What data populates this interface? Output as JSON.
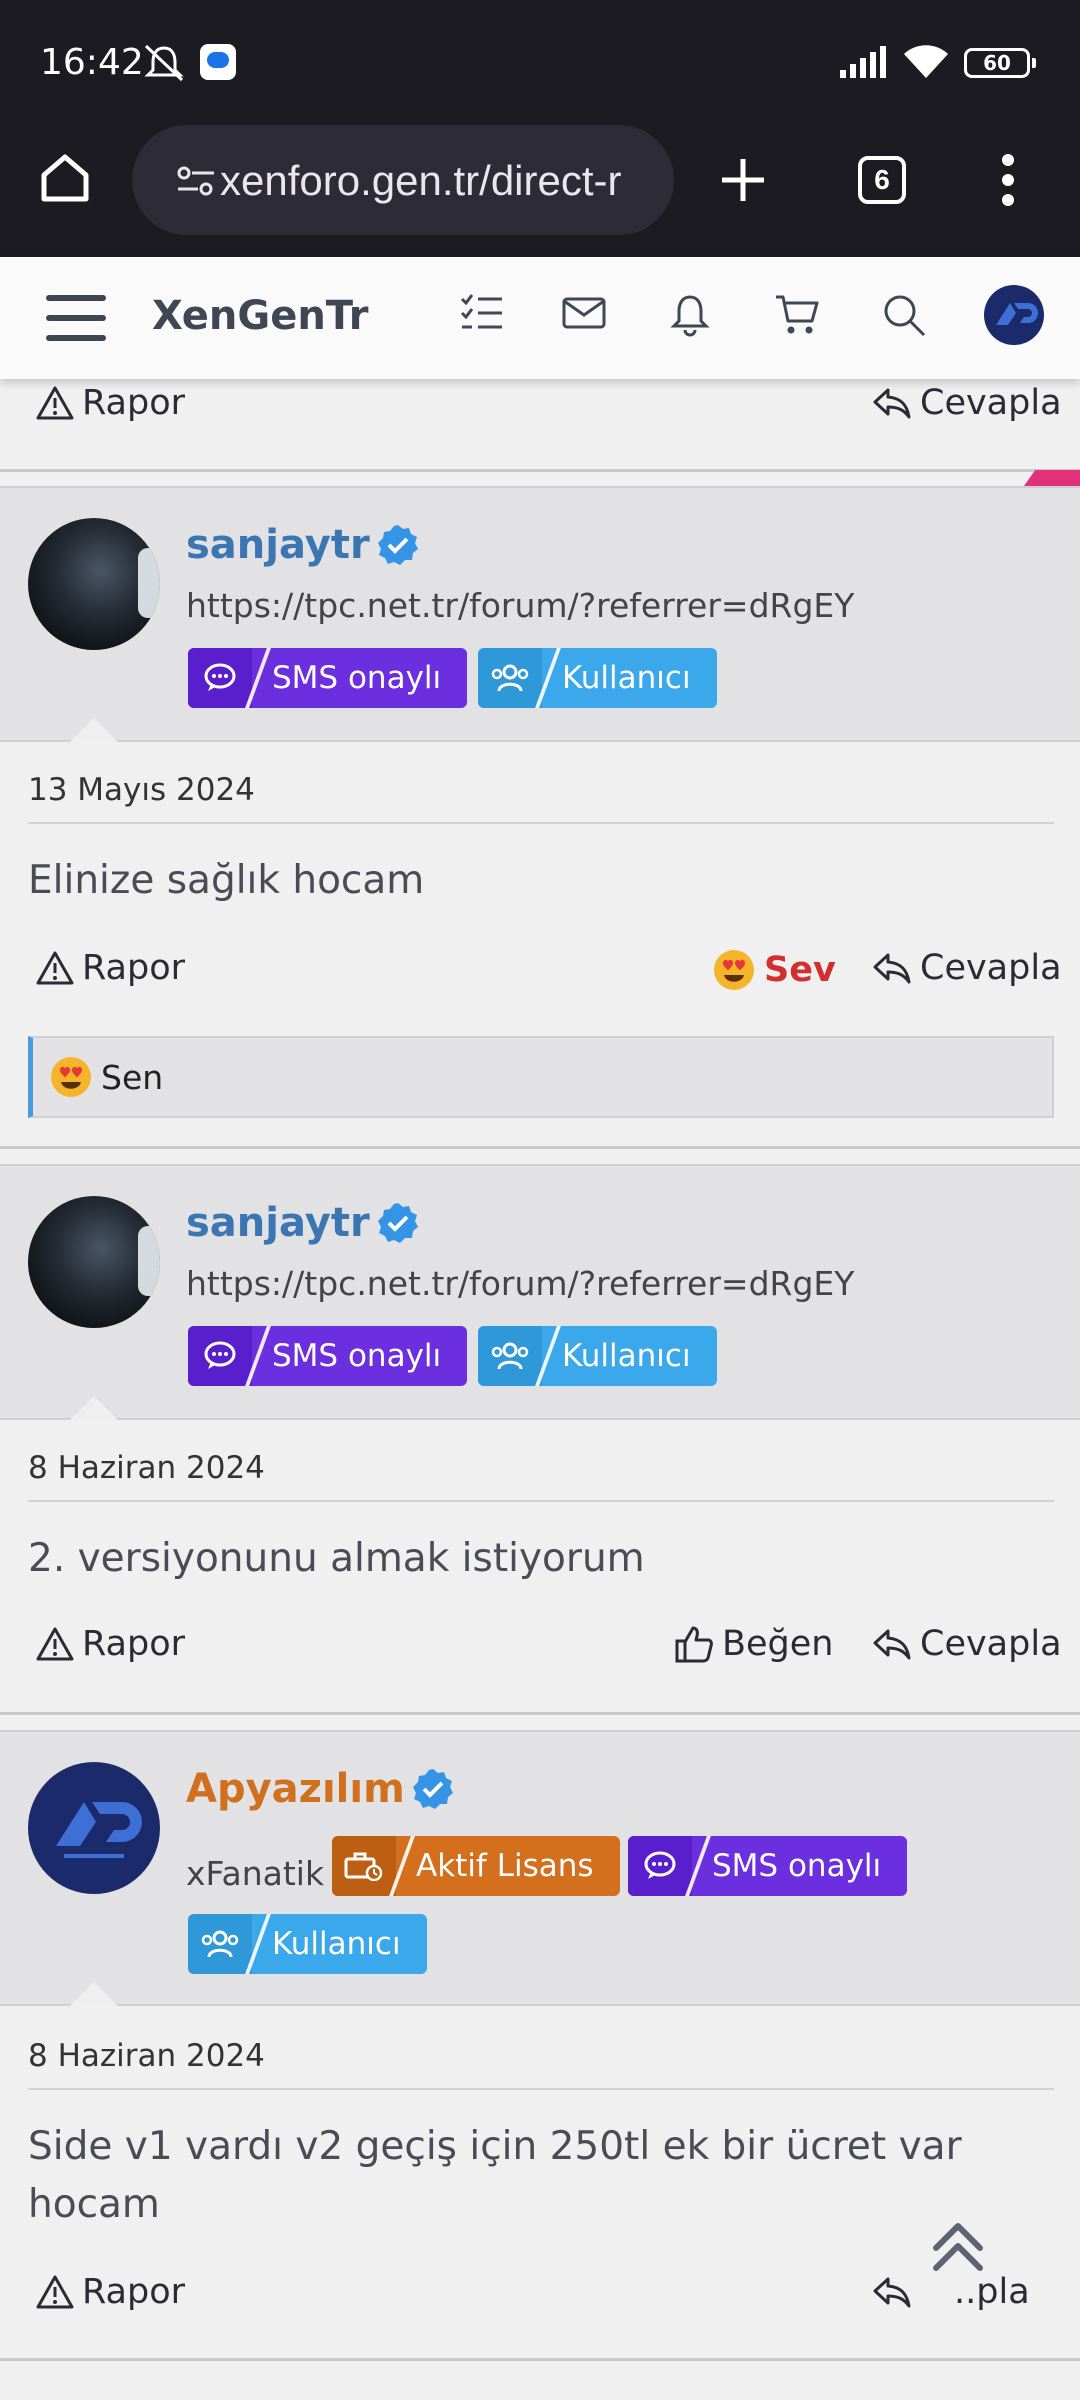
{
  "status_bar": {
    "time": "16:42",
    "battery": "60"
  },
  "browser": {
    "url": "xenforo.gen.tr/direct-r",
    "tab_count": "6"
  },
  "site": {
    "brand": "XenGenTr"
  },
  "top_actions": {
    "report": "Rapor",
    "reply": "Cevapla"
  },
  "posts": [
    {
      "author": "sanjaytr",
      "user_title": "https://tpc.net.tr/forum/?referrer=dRgEY",
      "badges": [
        "SMS onaylı",
        "Kullanıcı"
      ],
      "date": "13 Mayıs 2024",
      "body": "Elinize sağlık hocam",
      "actions": {
        "report": "Rapor",
        "reaction": "Sev",
        "reply": "Cevapla"
      },
      "reactions_summary": "Sen"
    },
    {
      "author": "sanjaytr",
      "user_title": "https://tpc.net.tr/forum/?referrer=dRgEY",
      "badges": [
        "SMS onaylı",
        "Kullanıcı"
      ],
      "date": "8 Haziran 2024",
      "body": "2. versiyonunu almak istiyorum",
      "actions": {
        "report": "Rapor",
        "like": "Beğen",
        "reply": "Cevapla"
      }
    },
    {
      "author": "Apyazılım",
      "user_title": "xFanatik",
      "badges": [
        "Aktif Lisans",
        "SMS onaylı",
        "Kullanıcı"
      ],
      "date": "8 Haziran 2024",
      "body": "Side v1 vardı v2 geçiş için 250tl ek bir ücret var hocam",
      "actions": {
        "report": "Rapor",
        "reply": "..pla"
      }
    }
  ],
  "colors": {
    "link_blue": "#3b76b3",
    "orange_user": "#d06f1e",
    "sms_badge": "#6b2fe0",
    "user_badge": "#3aa8ea",
    "license_badge": "#d36f1d",
    "love_red": "#d32f2f"
  }
}
